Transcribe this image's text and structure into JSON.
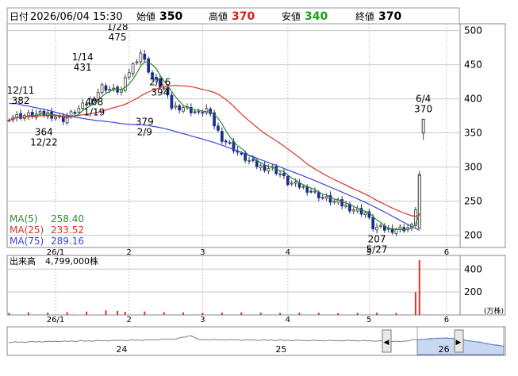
{
  "header": {
    "date_label": "日付",
    "datetime": "2026/06/04 15:30",
    "open_label": "始値",
    "open": "350",
    "high_label": "高値",
    "high": "370",
    "low_label": "安値",
    "low": "340",
    "close_label": "終値",
    "close": "370"
  },
  "colors": {
    "up": "#3a3a3a",
    "down": "#1c2f8c",
    "ma5": "#2e8b2e",
    "ma25": "#e0302a",
    "ma75": "#3b46d6",
    "volume": "#e0302a",
    "high_value": "#d81e1e",
    "low_value": "#18a018",
    "grid": "#c8c8c8",
    "frame": "#8a8a8a"
  },
  "chart_data": [
    {
      "type": "candlestick",
      "ylim": [
        182,
        510
      ],
      "y_ticks": [
        "500",
        "450",
        "400",
        "350",
        "300",
        "250",
        "200"
      ],
      "x_ticks": [
        "26/1",
        "2",
        "3",
        "4",
        "5",
        "6"
      ],
      "trading_days": 110,
      "month_start_index": {
        "26/1": 12,
        "2": 31,
        "3": 50,
        "4": 72,
        "5": 93,
        "6": 113
      },
      "close_path": [
        [
          0,
          373
        ],
        [
          5,
          376
        ],
        [
          10,
          378
        ],
        [
          14,
          370
        ],
        [
          18,
          385
        ],
        [
          22,
          402
        ],
        [
          24,
          418
        ],
        [
          27,
          412
        ],
        [
          29,
          413
        ],
        [
          31,
          440
        ],
        [
          34,
          468
        ],
        [
          37,
          430
        ],
        [
          40,
          415
        ],
        [
          42,
          388
        ],
        [
          45,
          388
        ],
        [
          49,
          378
        ],
        [
          51,
          385
        ],
        [
          53,
          362
        ],
        [
          55,
          342
        ],
        [
          57,
          333
        ],
        [
          60,
          316
        ],
        [
          63,
          305
        ],
        [
          65,
          300
        ],
        [
          68,
          298
        ],
        [
          70,
          290
        ],
        [
          72,
          277
        ],
        [
          75,
          272
        ],
        [
          78,
          265
        ],
        [
          81,
          255
        ],
        [
          85,
          247
        ],
        [
          88,
          240
        ],
        [
          90,
          236
        ],
        [
          92,
          233
        ],
        [
          94,
          212
        ],
        [
          96,
          210
        ],
        [
          98,
          208
        ],
        [
          102,
          210
        ],
        [
          104,
          212
        ],
        [
          105,
          240
        ],
        [
          106,
          288
        ]
      ],
      "last_candle": {
        "open": 350,
        "high": 370,
        "low": 340,
        "close": 370
      },
      "annotations": [
        {
          "date": "12/11",
          "value": "382",
          "index": 3,
          "kind": "high"
        },
        {
          "date": "12/22",
          "value": "364",
          "index": 9,
          "kind": "low"
        },
        {
          "date": "1/14",
          "value": "431",
          "index": 19,
          "kind": "high"
        },
        {
          "date": "1/19",
          "value": "408",
          "index": 22,
          "kind": "low"
        },
        {
          "date": "1/28",
          "value": "475",
          "index": 28,
          "kind": "high"
        },
        {
          "date": "2/9",
          "value": "379",
          "index": 35,
          "kind": "low"
        },
        {
          "date": "2/16",
          "value": "394",
          "index": 39,
          "kind": "high"
        },
        {
          "date": "5/27",
          "value": "207",
          "index": 95,
          "kind": "low"
        },
        {
          "date": "6/4",
          "value": "370",
          "index": 107,
          "kind": "high"
        }
      ],
      "moving_averages": [
        {
          "name": "MA(5)",
          "label_value": "258.40",
          "color": "#2e8b2e"
        },
        {
          "name": "MA(25)",
          "label_value": "233.52",
          "color": "#e0302a"
        },
        {
          "name": "MA(75)",
          "label_value": "289.16",
          "color": "#3b46d6"
        }
      ]
    },
    {
      "type": "bar",
      "label": "出来高",
      "latest_value": "4,799,000株",
      "unit": "(万株)",
      "y_ticks": [
        "400",
        "200"
      ],
      "ylim": [
        0,
        520
      ],
      "bars": [
        [
          0,
          18
        ],
        [
          5,
          22
        ],
        [
          10,
          20
        ],
        [
          15,
          25
        ],
        [
          20,
          30
        ],
        [
          25,
          40
        ],
        [
          28,
          35
        ],
        [
          30,
          28
        ],
        [
          35,
          30
        ],
        [
          40,
          25
        ],
        [
          45,
          22
        ],
        [
          50,
          18
        ],
        [
          55,
          20
        ],
        [
          60,
          22
        ],
        [
          65,
          20
        ],
        [
          70,
          18
        ],
        [
          75,
          20
        ],
        [
          80,
          18
        ],
        [
          85,
          16
        ],
        [
          90,
          18
        ],
        [
          95,
          20
        ],
        [
          100,
          18
        ],
        [
          105,
          200
        ],
        [
          106,
          480
        ]
      ]
    },
    {
      "type": "area",
      "role": "navigator",
      "year_labels": [
        "24",
        "25",
        "26"
      ],
      "year_label_index": {
        "24": 34,
        "25": 82,
        "26": 131
      },
      "points": 150,
      "ylim": [
        0,
        100
      ],
      "profile": [
        [
          0,
          45
        ],
        [
          10,
          48
        ],
        [
          20,
          50
        ],
        [
          30,
          52
        ],
        [
          40,
          54
        ],
        [
          50,
          58
        ],
        [
          55,
          72
        ],
        [
          57,
          56
        ],
        [
          65,
          55
        ],
        [
          75,
          54
        ],
        [
          85,
          53
        ],
        [
          95,
          52
        ],
        [
          105,
          52
        ],
        [
          112,
          50
        ],
        [
          118,
          48
        ],
        [
          122,
          55
        ],
        [
          126,
          58
        ],
        [
          130,
          62
        ],
        [
          134,
          60
        ],
        [
          138,
          52
        ],
        [
          142,
          45
        ],
        [
          146,
          35
        ],
        [
          149,
          30
        ]
      ],
      "window_start_index": 123
    }
  ]
}
